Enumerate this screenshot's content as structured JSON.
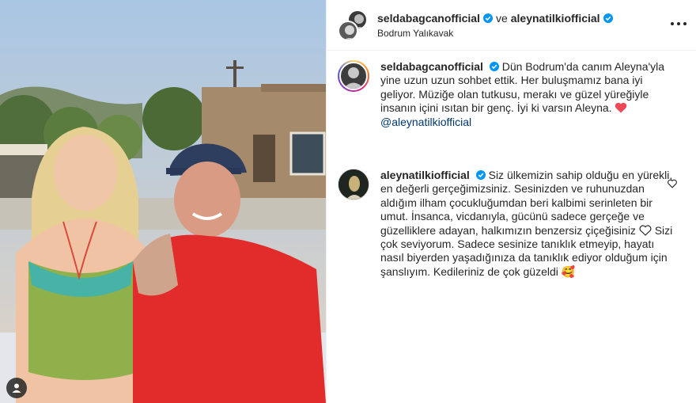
{
  "header": {
    "user1": "seldabagcanofficial",
    "connector": "ve",
    "user2": "aleynatilkiofficial",
    "location": "Bodrum Yalıkavak"
  },
  "caption": {
    "username": "seldabagcanofficial",
    "text": "Dün Bodrum'da canım Aleyna'yla yine uzun uzun sohbet ettik. Her buluşmamız bana iyi geliyor. Müziğe olan tutkusu, merakı ve güzel yüreğiyle insanın içini ısıtan bir genç. İyi ki varsın Aleyna.",
    "mention": "@aleynatilkiofficial"
  },
  "comment": {
    "username": "aleynatilkiofficial",
    "text1": "Siz ülkemizin sahip olduğu en yürekli, en değerli gerçeğimizsiniz. Sesinizden ve ruhunuzdan aldığım ilham çocukluğumdan beri kalbimi serinleten bir umut. İnsanca, vicdanıyla, gücünü sadece gerçeğe ve güzelliklere adayan, halkımızın benzersiz çiçeğisiniz",
    "text2": "Sizi çok seviyorum. Sadece sesinize tanıklık etmeyip, hayatı nasıl biyerden yaşadığınıza da tanıklık ediyor olduğum için şanslıyım. Kedileriniz de çok güzeldi",
    "emoji": "🥰"
  },
  "colors": {
    "verified": "#0095f6",
    "heart_red": "#ed4956",
    "link": "#00376b"
  },
  "icons": {
    "verified": "verified-badge-icon",
    "more": "more-options-icon",
    "like": "heart-outline-icon",
    "tag": "user-tag-icon"
  }
}
